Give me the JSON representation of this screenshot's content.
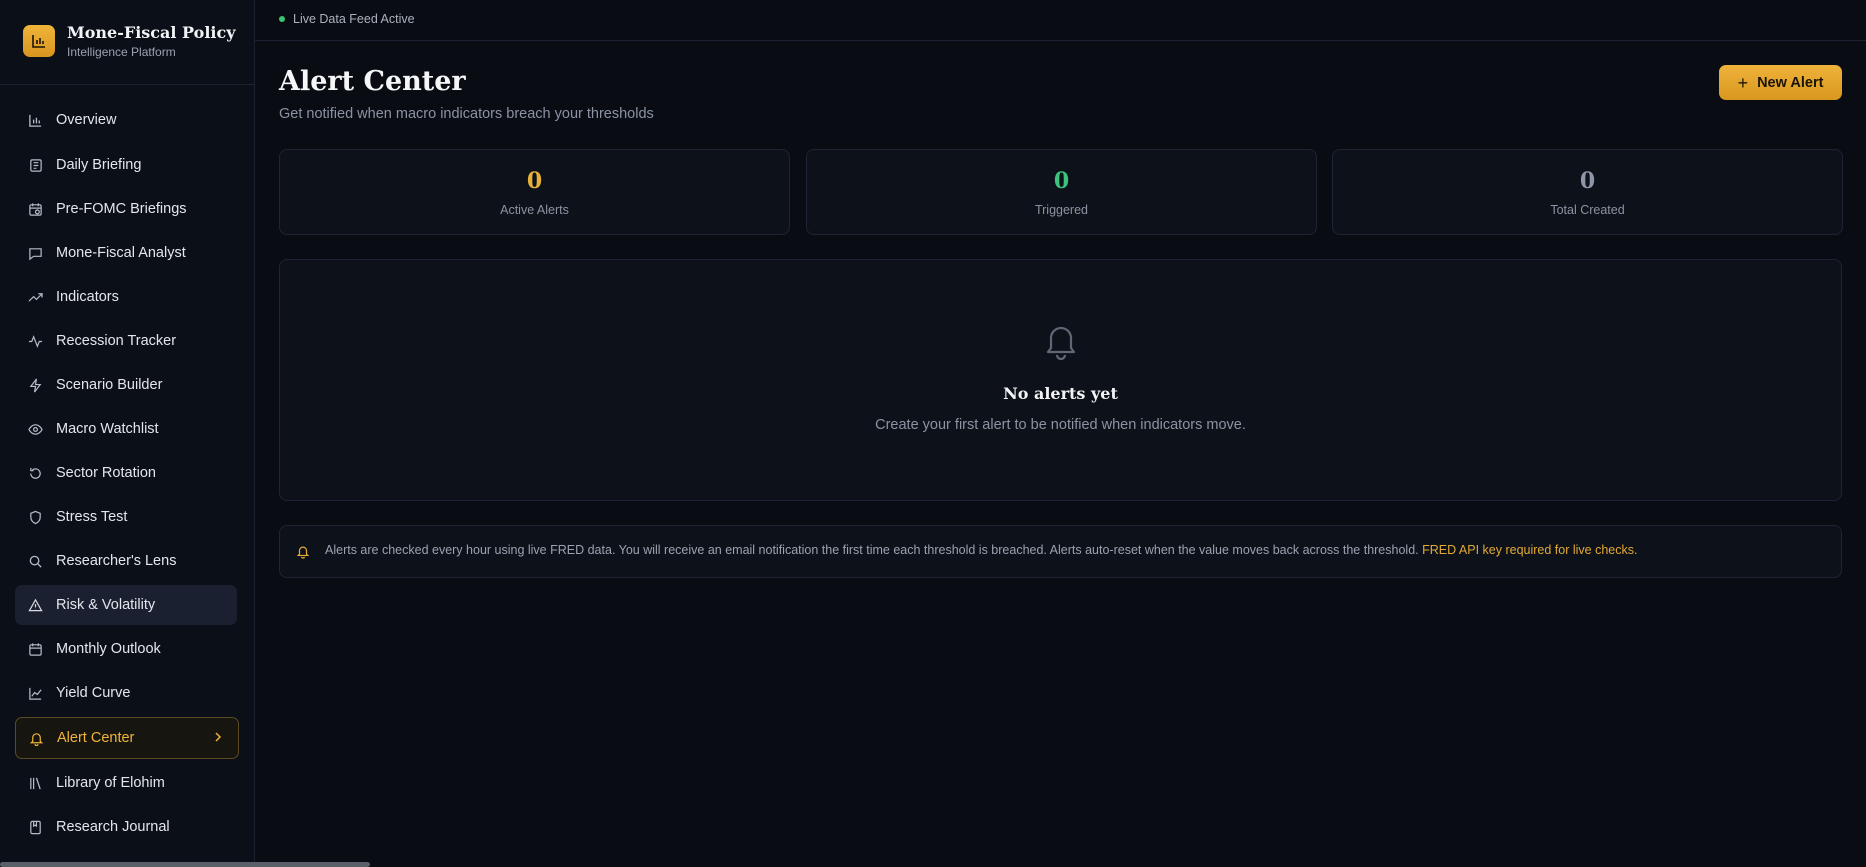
{
  "colors": {
    "accent": "#f0b43a",
    "green": "#39c472",
    "muted": "#8b93a3"
  },
  "brand": {
    "title": "Mone-Fiscal Policy",
    "subtitle": "Intelligence Platform",
    "icon": "bar-chart-icon"
  },
  "sidebar": {
    "items": [
      {
        "label": "Overview",
        "icon": "bar-chart-icon"
      },
      {
        "label": "Daily Briefing",
        "icon": "newspaper-icon"
      },
      {
        "label": "Pre-FOMC Briefings",
        "icon": "calendar-clock-icon"
      },
      {
        "label": "Mone-Fiscal Analyst",
        "icon": "chat-icon"
      },
      {
        "label": "Indicators",
        "icon": "trending-up-icon"
      },
      {
        "label": "Recession Tracker",
        "icon": "activity-icon"
      },
      {
        "label": "Scenario Builder",
        "icon": "lightning-icon"
      },
      {
        "label": "Macro Watchlist",
        "icon": "eye-icon"
      },
      {
        "label": "Sector Rotation",
        "icon": "rotate-icon"
      },
      {
        "label": "Stress Test",
        "icon": "shield-icon"
      },
      {
        "label": "Researcher's Lens",
        "icon": "search-icon"
      },
      {
        "label": "Risk & Volatility",
        "icon": "warning-triangle-icon"
      },
      {
        "label": "Monthly Outlook",
        "icon": "calendar-icon"
      },
      {
        "label": "Yield Curve",
        "icon": "line-chart-icon"
      },
      {
        "label": "Alert Center",
        "icon": "bell-icon"
      },
      {
        "label": "Library of Elohim",
        "icon": "library-icon"
      },
      {
        "label": "Research Journal",
        "icon": "book-icon"
      }
    ],
    "active": "Alert Center",
    "hovered": "Risk & Volatility"
  },
  "topbar": {
    "status": "Live Data Feed Active"
  },
  "header": {
    "title": "Alert Center",
    "subtitle": "Get notified when macro indicators breach your thresholds",
    "new_button": "New Alert"
  },
  "stats": [
    {
      "value": "0",
      "label": "Active Alerts",
      "color": "#e6b13b"
    },
    {
      "value": "0",
      "label": "Triggered",
      "color": "#3cc47a"
    },
    {
      "value": "0",
      "label": "Total Created",
      "color": "#8d97a8"
    }
  ],
  "empty_state": {
    "title": "No alerts yet",
    "message": "Create your first alert to be notified when indicators move."
  },
  "info": {
    "text": "Alerts are checked every hour using live FRED data. You will receive an email notification the first time each threshold is breached. Alerts auto-reset when the value moves back across the threshold.",
    "warning": "FRED API key required for live checks."
  }
}
